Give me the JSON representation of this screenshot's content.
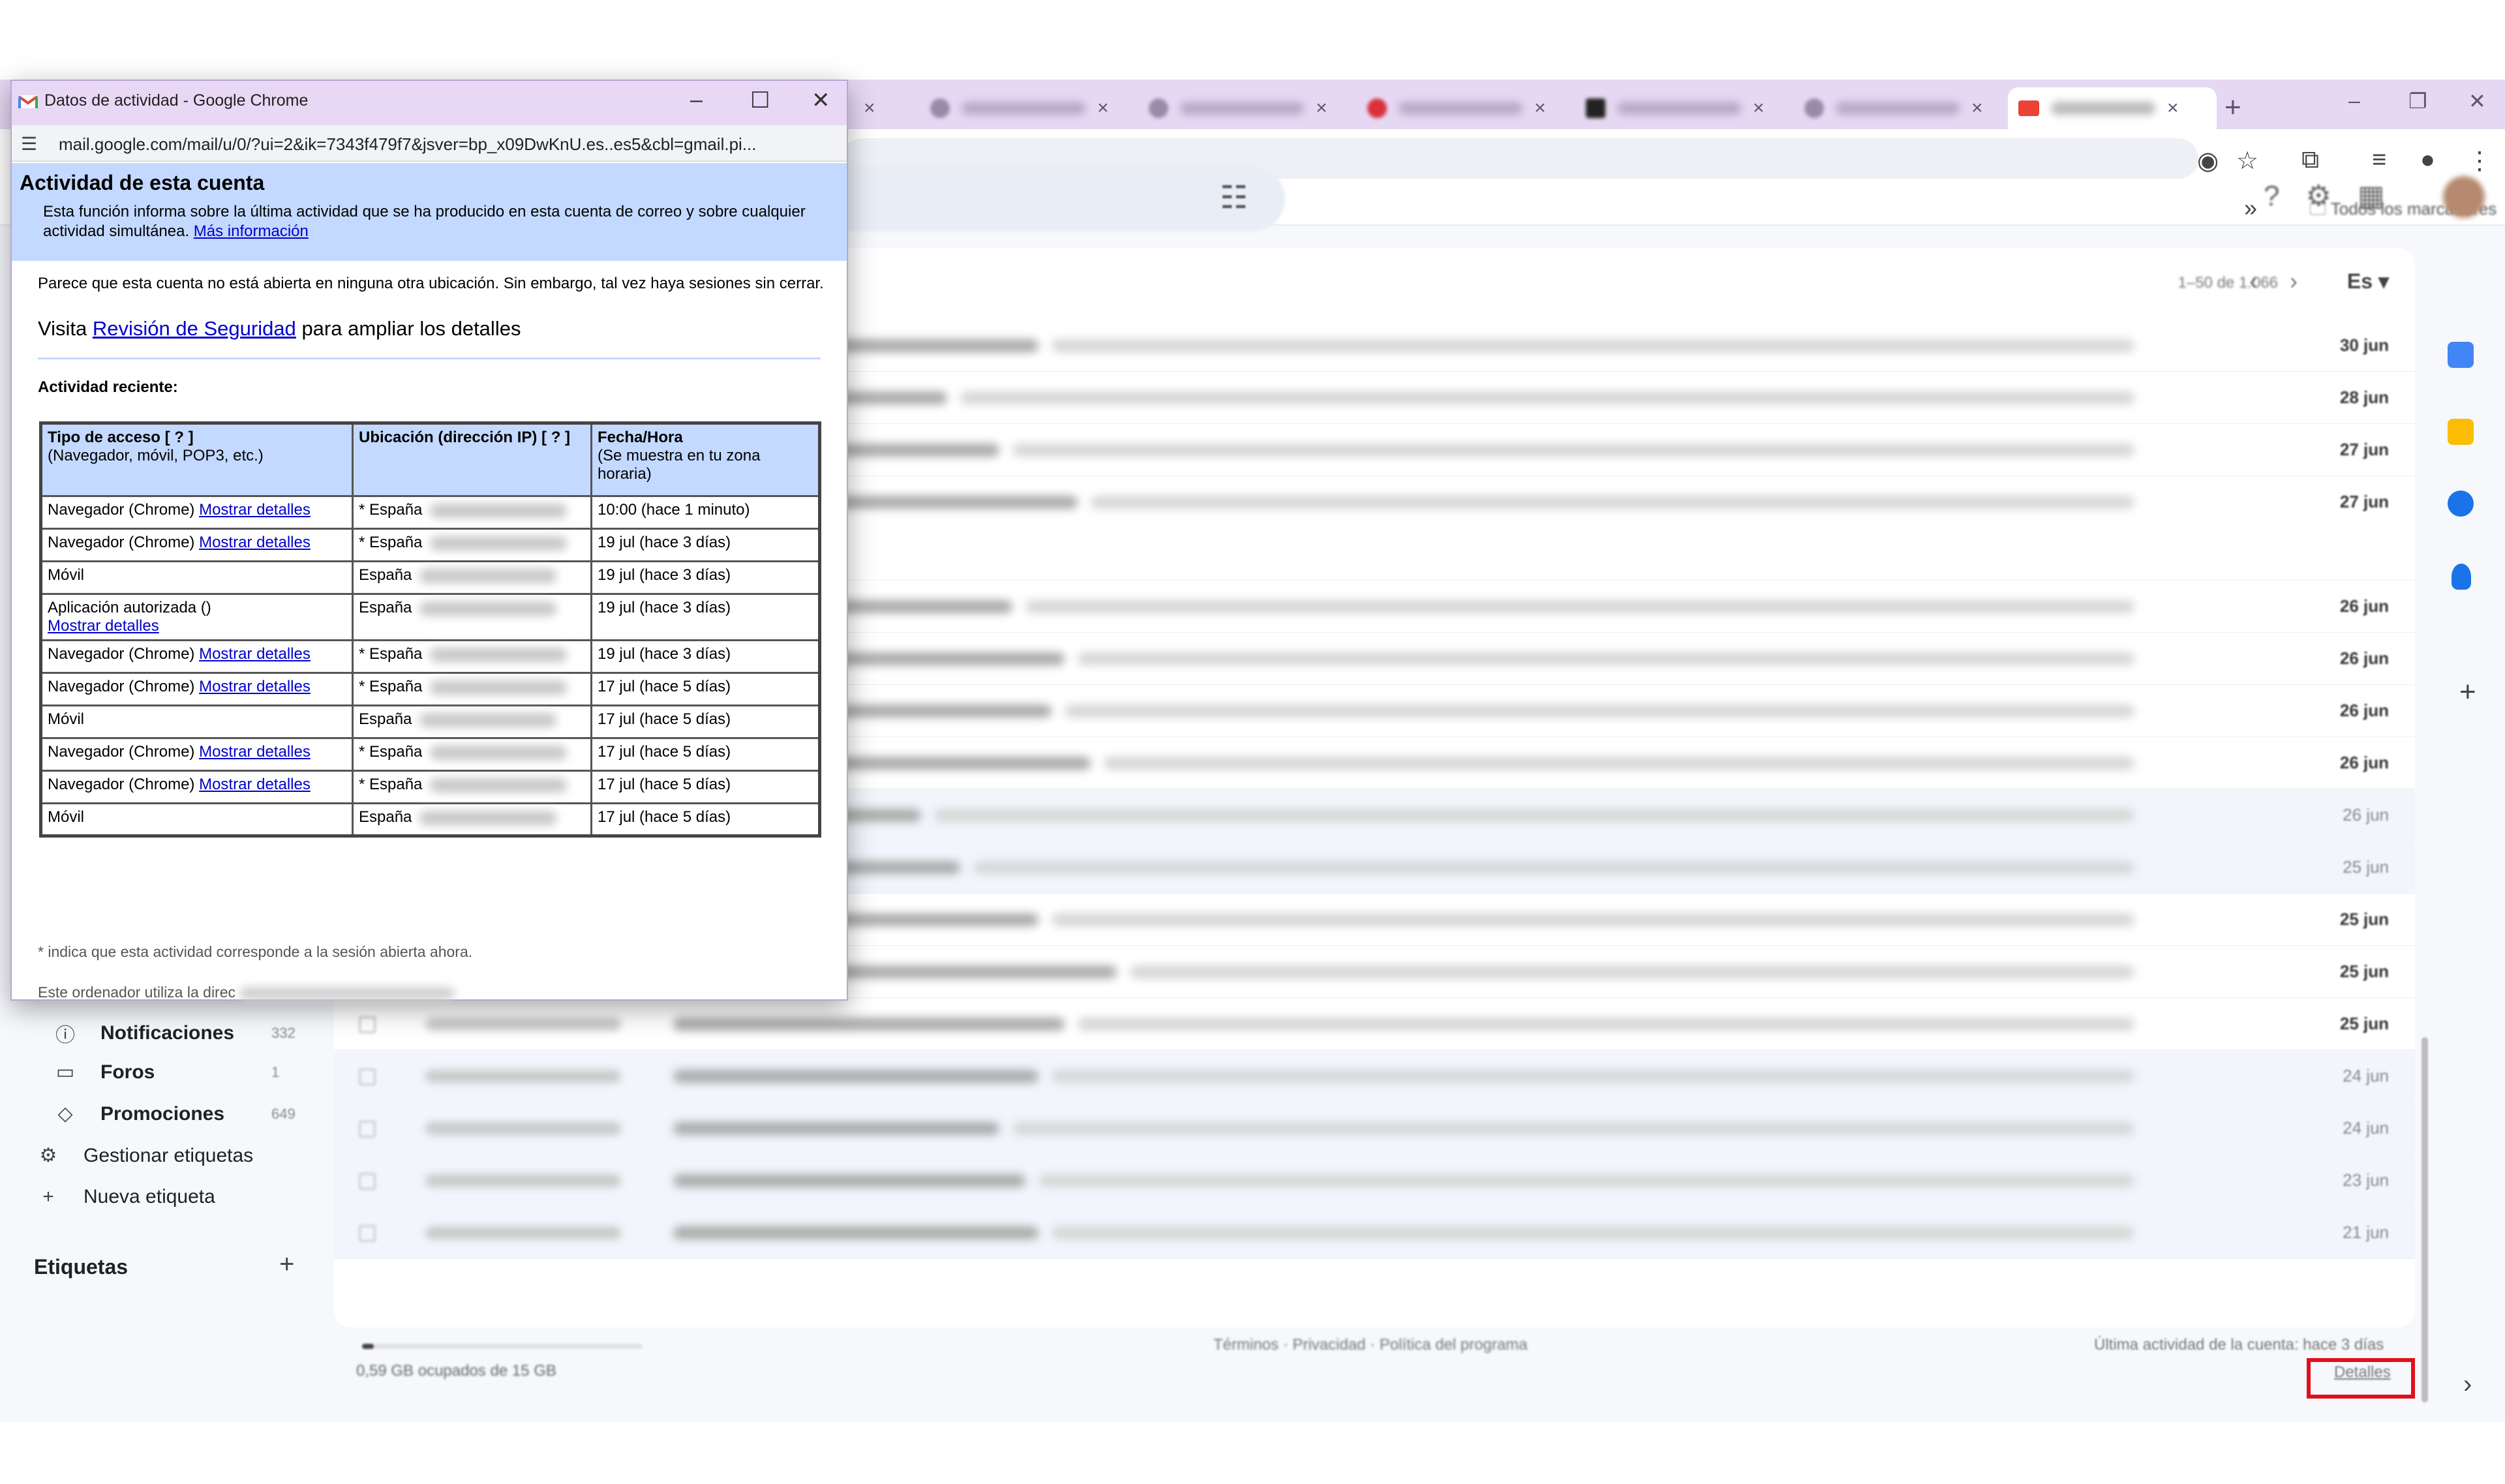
{
  "popup": {
    "window_title": "Datos de actividad - Google Chrome",
    "url": "mail.google.com/mail/u/0/?ui=2&ik=7343f479f7&jsver=bp_x09DwKnU.es..es5&cbl=gmail.pi...",
    "heading": "Actividad de esta cuenta",
    "description": "Esta función informa sobre la última actividad que se ha producido en esta cuenta de correo y sobre cualquier actividad simultánea.",
    "more_info_link": "Más información",
    "status_text": "Parece que esta cuenta no está abierta en ninguna otra ubicación. Sin embargo, tal vez haya sesiones sin cerrar.",
    "review_prefix": "Visita",
    "review_link": "Revisión de Seguridad",
    "review_suffix": "para ampliar los detalles",
    "recent_label": "Actividad reciente:",
    "table": {
      "headers": [
        {
          "title": "Tipo de acceso [ ? ]",
          "sub": "(Navegador, móvil, POP3, etc.)"
        },
        {
          "title": "Ubicación (dirección IP) [ ? ]",
          "sub": ""
        },
        {
          "title": "Fecha/Hora",
          "sub": "(Se muestra en tu zona horaria)"
        }
      ],
      "rows": [
        {
          "access": "Navegador (Chrome)",
          "link": "Mostrar detalles",
          "location": "* España",
          "datetime": "10:00 (hace 1 minuto)"
        },
        {
          "access": "Navegador (Chrome)",
          "link": "Mostrar detalles",
          "location": "* España",
          "datetime": "19 jul (hace 3 días)"
        },
        {
          "access": "Móvil",
          "link": "",
          "location": "España",
          "datetime": "19 jul (hace 3 días)"
        },
        {
          "access": "Aplicación autorizada ()",
          "link": "Mostrar detalles",
          "location": "España",
          "datetime": "19 jul (hace 3 días)"
        },
        {
          "access": "Navegador (Chrome)",
          "link": "Mostrar detalles",
          "location": "* España",
          "datetime": "19 jul (hace 3 días)"
        },
        {
          "access": "Navegador (Chrome)",
          "link": "Mostrar detalles",
          "location": "* España",
          "datetime": "17 jul (hace 5 días)"
        },
        {
          "access": "Móvil",
          "link": "",
          "location": "España",
          "datetime": "17 jul (hace 5 días)"
        },
        {
          "access": "Navegador (Chrome)",
          "link": "Mostrar detalles",
          "location": "* España",
          "datetime": "17 jul (hace 5 días)"
        },
        {
          "access": "Navegador (Chrome)",
          "link": "Mostrar detalles",
          "location": "* España",
          "datetime": "17 jul (hace 5 días)"
        },
        {
          "access": "Móvil",
          "link": "",
          "location": "España",
          "datetime": "17 jul (hace 5 días)"
        }
      ]
    },
    "note": "* indica que esta actividad corresponde a la sesión abierta ahora.",
    "computer_prefix": "Este ordenador utiliza la direc"
  },
  "gmail": {
    "pager": "1–50 de 1.066",
    "lang": "Es ▾",
    "bookmarks_folder": "Todos los marcadores",
    "dates": [
      "30 jun",
      "28 jun",
      "27 jun",
      "27 jun",
      "26 jun",
      "26 jun",
      "26 jun",
      "26 jun",
      "26 jun",
      "25 jun",
      "25 jun",
      "25 jun",
      "25 jun",
      "24 jun",
      "24 jun",
      "23 jun",
      "21 jun"
    ],
    "sidebar": [
      {
        "icon": "ⓘ",
        "label": "Notificaciones",
        "count": "332"
      },
      {
        "icon": "▭",
        "label": "Foros",
        "count": "1"
      },
      {
        "icon": "◇",
        "label": "Promociones",
        "count": "649"
      },
      {
        "icon": "⚙",
        "label": "Gestionar etiquetas",
        "count": ""
      },
      {
        "icon": "+",
        "label": "Nueva etiqueta",
        "count": ""
      }
    ],
    "labels_heading": "Etiquetas",
    "storage": "0,59 GB ocupados de 15 GB",
    "footer_links": "Términos · Privacidad · Política del programa",
    "last_activity": "Última actividad de la cuenta: hace 3 días",
    "details_link": "Detalles"
  },
  "colors": {
    "highlight": "#e0101a",
    "popup_header_bg": "#c3d9ff",
    "link": "#0000cc"
  }
}
